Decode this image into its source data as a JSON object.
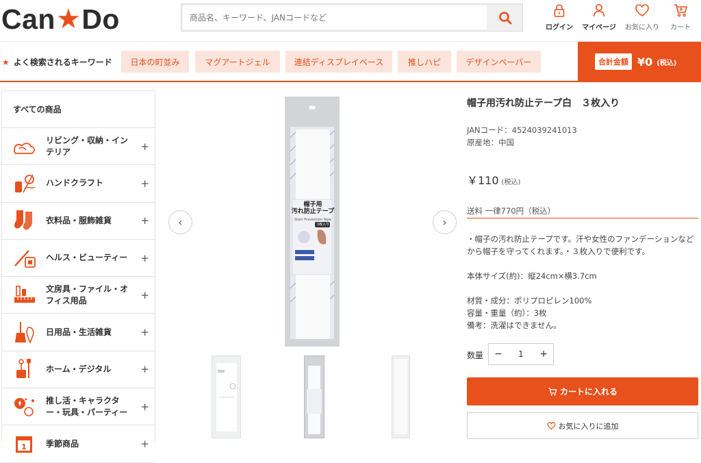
{
  "header": {
    "logo_left": "Can",
    "logo_right": "Do",
    "search_placeholder": "商品名、キーワード、JANコードなど",
    "icons": [
      {
        "name": "lock-icon",
        "label": "ログイン"
      },
      {
        "name": "person-icon",
        "label": "マイページ"
      },
      {
        "name": "heart-icon",
        "label": "お気に入り"
      },
      {
        "name": "cart-icon",
        "label": "カート"
      }
    ]
  },
  "keywords": {
    "title": "よく検索されるキーワード",
    "chips": [
      "日本の町並み",
      "マグアートジェル",
      "連結ディスプレイベース",
      "推しハピ",
      "デザインペーパー"
    ]
  },
  "cart_total": {
    "label": "合計金額",
    "amount": "¥0",
    "tax": "(税込)"
  },
  "sidebar": {
    "all_label": "すべての商品",
    "items": [
      {
        "label": "リビング・収納・インテリア",
        "icon": "living-icon"
      },
      {
        "label": "ハンドクラフト",
        "icon": "craft-icon"
      },
      {
        "label": "衣料品・服飾雑貨",
        "icon": "socks-icon"
      },
      {
        "label": "ヘルス・ビューティー",
        "icon": "beauty-icon"
      },
      {
        "label": "文房具・ファイル・オフィス用品",
        "icon": "stationery-icon"
      },
      {
        "label": "日用品・生活雑貨",
        "icon": "broom-icon"
      },
      {
        "label": "ホーム・デジタル",
        "icon": "tools-icon"
      },
      {
        "label": "推し活・キャラクター・玩具・パーティー",
        "icon": "party-icon"
      },
      {
        "label": "季節商品",
        "icon": "calendar-icon"
      }
    ]
  },
  "product": {
    "title": "帽子用汚れ防止テープ白　３枚入り",
    "jan": "JANコード：4524039241013",
    "origin": "原産地：中国",
    "price": "￥110",
    "price_tax": "(税込)",
    "shipping": "送料 一律770円（税込）",
    "description": [
      "・帽子の汚れ防止テープです。汗や女性のファンデーションなどから帽子を守ってくれます。・３枚入りで便利です。",
      "",
      "本体サイズ(約)：縦24cm×横3.7cm",
      "",
      "材質・成分：ポリプロピレン100%",
      "容量・重量（約）：3枚",
      "備考：洗濯はできません。"
    ],
    "package_text": {
      "line1": "帽子用",
      "line2": "汚れ防止テープ",
      "line3": "Stain Prevention Tape",
      "badge": "3枚入り"
    },
    "quantity_label": "数量",
    "quantity": "1",
    "add_to_cart": "カートに入れる",
    "add_to_favorites": "お気に入りに追加"
  },
  "colors": {
    "accent": "#e8501c",
    "chip_bg": "#fbe4db"
  }
}
